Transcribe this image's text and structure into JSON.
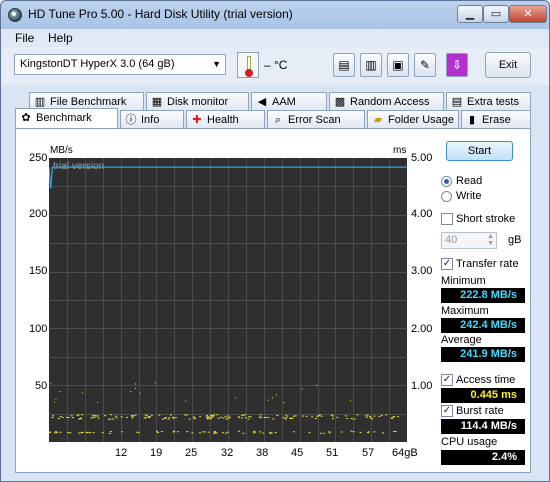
{
  "window": {
    "title": "HD Tune Pro 5.00 - Hard Disk Utility (trial version)"
  },
  "titlebar": {
    "minimize": "▁",
    "maximize": "▭",
    "close": "✕"
  },
  "menu": [
    {
      "label": "File"
    },
    {
      "label": "Help"
    }
  ],
  "toolbar": {
    "drive": "KingstonDT HyperX 3.0     (64 gB)",
    "temperature": "– °C",
    "exit_label": "Exit",
    "icons": [
      "copy-text-icon",
      "copy-image-icon",
      "save-icon",
      "options-icon",
      "download-icon"
    ]
  },
  "tabs_top": [
    {
      "label": "File Benchmark",
      "icon": "file-benchmark-icon"
    },
    {
      "label": "Disk monitor",
      "icon": "disk-monitor-icon"
    },
    {
      "label": "AAM",
      "icon": "speaker-icon"
    },
    {
      "label": "Random Access",
      "icon": "random-access-icon"
    },
    {
      "label": "Extra tests",
      "icon": "extra-tests-icon"
    }
  ],
  "tabs_bottom": [
    {
      "label": "Benchmark",
      "icon": "benchmark-icon"
    },
    {
      "label": "Info",
      "icon": "info-icon"
    },
    {
      "label": "Health",
      "icon": "health-icon"
    },
    {
      "label": "Error Scan",
      "icon": "error-scan-icon"
    },
    {
      "label": "Folder Usage",
      "icon": "folder-icon"
    },
    {
      "label": "Erase",
      "icon": "erase-icon"
    }
  ],
  "chart_data": {
    "type": "line",
    "watermark": "trial version",
    "y_left_unit": "MB/s",
    "y_right_unit": "ms",
    "y_left_ticks": [
      250,
      200,
      150,
      100,
      50
    ],
    "y_right_ticks": [
      "5.00",
      "4.00",
      "3.00",
      "2.00",
      "1.00"
    ],
    "x_ticks": [
      "12",
      "19",
      "25",
      "32",
      "38",
      "45",
      "51",
      "57",
      "64gB"
    ],
    "ylim_left": [
      0,
      250
    ],
    "ylim_right": [
      0,
      5
    ],
    "xlim": [
      0,
      64
    ],
    "series": [
      {
        "color": "#35a6e8",
        "values": [
          {
            "x": 0,
            "y": 242
          },
          {
            "x": 0.3,
            "y": 223
          },
          {
            "x": 0.6,
            "y": 242
          },
          {
            "x": 64,
            "y": 242
          }
        ]
      },
      {
        "color": "#e6e23a",
        "points": "access-time scatter near 0.45 ms"
      }
    ]
  },
  "controls": {
    "start_label": "Start",
    "read_label": "Read",
    "write_label": "Write",
    "short_stroke_label": "Short stroke",
    "short_stroke_value": "40",
    "short_stroke_unit": "gB",
    "transfer_rate_label": "Transfer rate",
    "minimum_label": "Minimum",
    "minimum_value": "222.8 MB/s",
    "maximum_label": "Maximum",
    "maximum_value": "242.4 MB/s",
    "average_label": "Average",
    "average_value": "241.9 MB/s",
    "access_time_label": "Access time",
    "access_time_value": "0.445 ms",
    "burst_rate_label": "Burst rate",
    "burst_rate_value": "114.4 MB/s",
    "cpu_label": "CPU usage",
    "cpu_value": "2.4%"
  }
}
